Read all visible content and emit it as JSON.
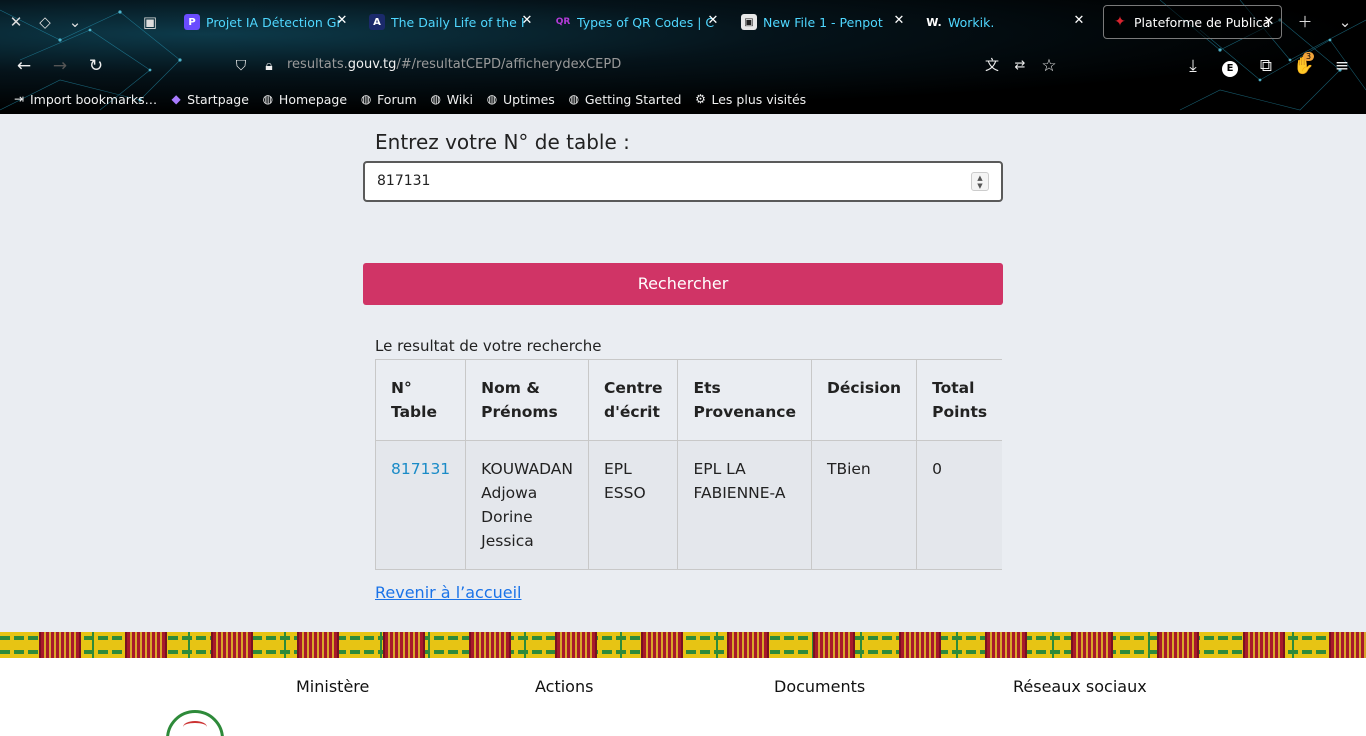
{
  "browser": {
    "tabs": [
      {
        "title": "Projet IA Détection Gr",
        "favicon": "P",
        "color": "#6a4cff"
      },
      {
        "title": "The Daily Life of the I",
        "favicon": "A",
        "color": "#1b2a6b"
      },
      {
        "title": "Types of QR Codes | C",
        "favicon": "QR",
        "color": "#b43bd8"
      },
      {
        "title": "New File 1 - Penpot",
        "favicon": "▣",
        "color": "#e8e8e8"
      },
      {
        "title": "Workik.",
        "favicon": "W.",
        "color": "#222"
      },
      {
        "title": "Plateforme de Publica",
        "favicon": "✦",
        "color": "#d8242f",
        "active": true
      }
    ],
    "url_prefix": "resultats.",
    "url_host": "gouv.tg",
    "url_path": "/#/resultatCEPD/afficherydexCEPD",
    "extension_badge": "3",
    "profile_initial": "E",
    "bookmarks": [
      {
        "label": "Import bookmarks…",
        "icon": "import-icon"
      },
      {
        "label": "Startpage",
        "icon": "startpage-icon"
      },
      {
        "label": "Homepage",
        "icon": "globe-icon"
      },
      {
        "label": "Forum",
        "icon": "globe-icon"
      },
      {
        "label": "Wiki",
        "icon": "globe-icon"
      },
      {
        "label": "Uptimes",
        "icon": "globe-icon"
      },
      {
        "label": "Getting Started",
        "icon": "globe-icon"
      },
      {
        "label": "Les plus visités",
        "icon": "gear-icon"
      }
    ]
  },
  "form": {
    "label": "Entrez votre N° de table :",
    "table_number": "817131",
    "search_button": "Rechercher"
  },
  "results": {
    "caption": "Le resultat de votre recherche",
    "headers": [
      "N° Table",
      "Nom & Prénoms",
      "Centre d'écrit",
      "Ets Provenance",
      "Décision",
      "Total Points"
    ],
    "rows": [
      {
        "table_number": "817131",
        "name": "KOUWADAN Adjowa Dorine Jessica",
        "centre": "EPL ESSO",
        "provenance": "EPL LA FABIENNE-A",
        "decision": "TBien",
        "total_points": "0"
      }
    ]
  },
  "back_link": "Revenir à l’accueil",
  "footer": {
    "columns": [
      "Ministère",
      "Actions",
      "Documents",
      "Réseaux sociaux"
    ]
  },
  "colors": {
    "accent_button": "#d03466",
    "link": "#1a73e8",
    "table_number_link": "#1a8bc7"
  }
}
